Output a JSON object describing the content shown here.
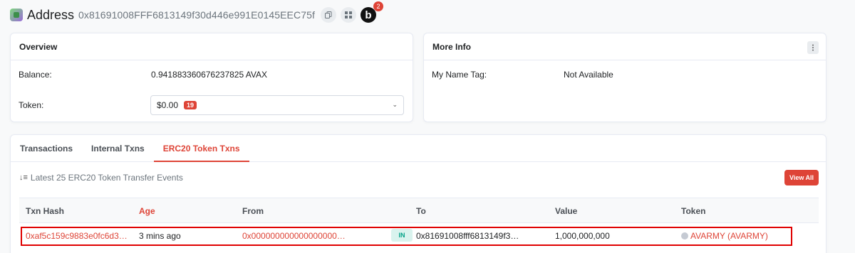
{
  "header": {
    "title": "Address",
    "address": "0x81691008FFF6813149f30d446e991E0145EEC75f",
    "notification_count": "2",
    "bubble_label": "b"
  },
  "overview": {
    "title": "Overview",
    "balance_label": "Balance:",
    "balance_value": "0.941883360676237825 AVAX",
    "token_label": "Token:",
    "token_value": "$0.00",
    "token_count": "19"
  },
  "more_info": {
    "title": "More Info",
    "name_tag_label": "My Name Tag:",
    "name_tag_value": "Not Available"
  },
  "tabs": [
    "Transactions",
    "Internal Txns",
    "ERC20 Token Txns"
  ],
  "active_tab": 2,
  "transfers": {
    "summary": "Latest 25 ERC20 Token Transfer Events",
    "view_all": "View All",
    "columns": [
      "Txn Hash",
      "Age",
      "From",
      "To",
      "Value",
      "Token"
    ],
    "rows": [
      {
        "txn_hash": "0xaf5c159c9883e0fc6d3…",
        "age": "3 mins ago",
        "from": "0x000000000000000000…",
        "direction": "IN",
        "to": "0x81691008fff6813149f3…",
        "value": "1,000,000,000",
        "token": "AVARMY (AVARMY)"
      }
    ]
  },
  "colors": {
    "accent": "#de4437",
    "in_badge": "#00a186"
  }
}
